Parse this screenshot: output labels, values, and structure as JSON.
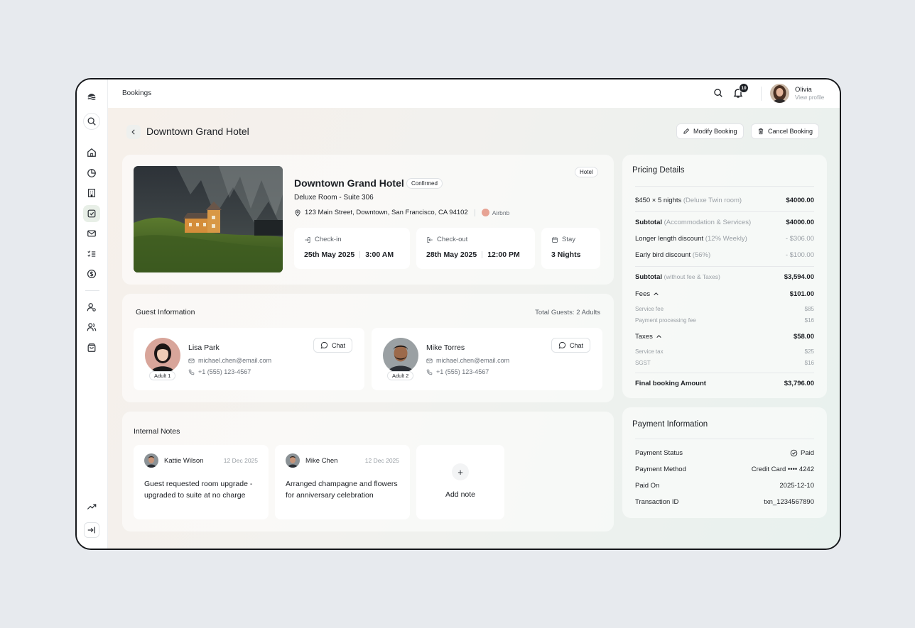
{
  "topbar": {
    "breadcrumb": "Bookings",
    "notification_count": "10",
    "user_name": "Olivia",
    "user_sub": "View profile"
  },
  "sidebar": {
    "icons": [
      "logo-icon",
      "search-icon",
      "home-icon",
      "pie-chart-icon",
      "building-icon",
      "calendar-check-icon",
      "mail-icon",
      "checklist-icon",
      "dollar-icon",
      "user-settings-icon",
      "users-icon",
      "bag-icon",
      "trend-icon",
      "collapse-icon"
    ]
  },
  "header": {
    "title": "Downtown Grand Hotel",
    "modify_label": "Modify Booking",
    "cancel_label": "Cancel Booking"
  },
  "hotel": {
    "name": "Downtown Grand Hotel",
    "status": "Confirmed",
    "category": "Hotel",
    "room": "Deluxe Room - Suite 306",
    "address": "123 Main Street, Downtown, San Francisco, CA 94102",
    "source": "Airbnb",
    "checkin_label": "Check-in",
    "checkin_date": "25th May 2025",
    "checkin_time": "3:00 AM",
    "checkout_label": "Check-out",
    "checkout_date": "28th May 2025",
    "checkout_time": "12:00 PM",
    "stay_label": "Stay",
    "stay_value": "3 Nights"
  },
  "guests": {
    "title": "Guest Information",
    "total": "Total Guests: 2 Adults",
    "chat_label": "Chat",
    "list": [
      {
        "name": "Lisa Park",
        "tag": "Adult 1",
        "email": "michael.chen@email.com",
        "phone": "+1 (555) 123-4567"
      },
      {
        "name": "Mike Torres",
        "tag": "Adult 2",
        "email": "michael.chen@email.com",
        "phone": "+1 (555) 123-4567"
      }
    ]
  },
  "notes": {
    "title": "Internal Notes",
    "add_label": "Add note",
    "list": [
      {
        "author": "Kattie Wilson",
        "date": "12 Dec 2025",
        "text": "Guest requested room upgrade - upgraded to suite at no charge"
      },
      {
        "author": "Mike Chen",
        "date": "12 Dec 2025",
        "text": "Arranged champagne and flowers for anniversary celebration"
      }
    ]
  },
  "pricing": {
    "title": "Pricing Details",
    "base_label": "$450 × 5 nights",
    "base_note": "(Deluxe Twin room)",
    "base_value": "$4000.00",
    "subtotal1_label": "Subtotal",
    "subtotal1_note": "(Accommodation & Services)",
    "subtotal1_value": "$4000.00",
    "disc1_label": "Longer length discount",
    "disc1_note": "(12% Weekly)",
    "disc1_value": "- $306.00",
    "disc2_label": "Early bird discount",
    "disc2_note": "(56%)",
    "disc2_value": "- $100.00",
    "subtotal2_label": "Subtotal",
    "subtotal2_note": "(without fee & Taxes)",
    "subtotal2_value": "$3,594.00",
    "fees_label": "Fees",
    "fees_value": "$101.00",
    "service_fee_label": "Service fee",
    "service_fee_value": "$85",
    "processing_fee_label": "Payment processing fee",
    "processing_fee_value": "$16",
    "taxes_label": "Taxes",
    "taxes_value": "$58.00",
    "service_tax_label": "Service tax",
    "service_tax_value": "$25",
    "sgst_label": "SGST",
    "sgst_value": "$16",
    "final_label": "Final booking Amount",
    "final_value": "$3,796.00"
  },
  "payment": {
    "title": "Payment Information",
    "status_label": "Payment Status",
    "status_value": "Paid",
    "method_label": "Payment Method",
    "method_value": "Credit Card •••• 4242",
    "paid_on_label": "Paid On",
    "paid_on_value": "2025-12-10",
    "txn_label": "Transaction ID",
    "txn_value": "txn_1234567890"
  }
}
